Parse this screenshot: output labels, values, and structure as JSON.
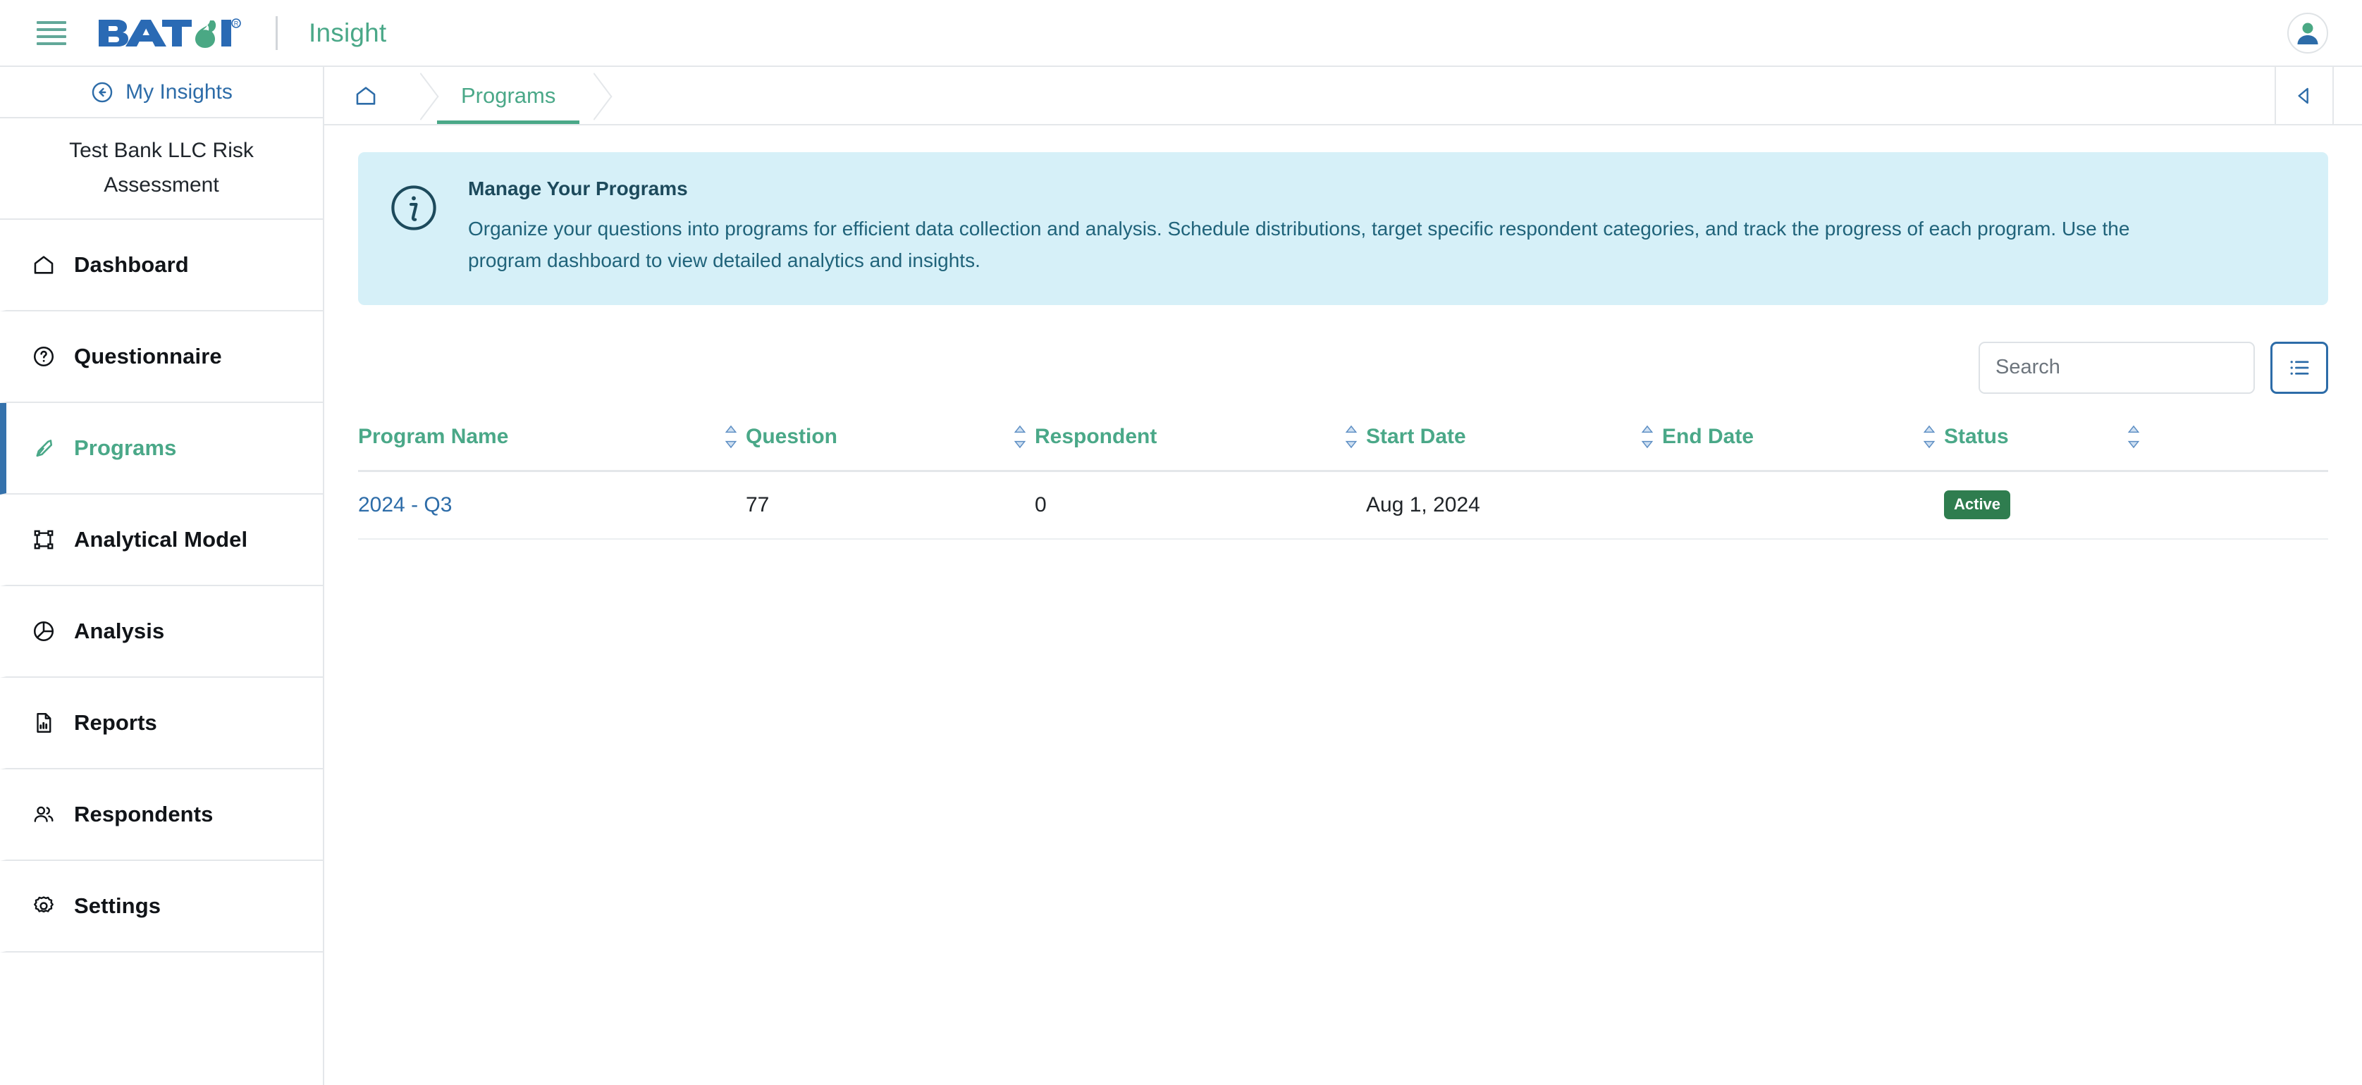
{
  "topbar": {
    "menu_icon": "hamburger-icon",
    "logo_text": "BATOI",
    "logo_tm": "®",
    "app_name": "Insight",
    "avatar_icon": "user-avatar-icon"
  },
  "sidebar": {
    "back_link": "My Insights",
    "back_icon": "arrow-left-circle-icon",
    "org_name": "Test Bank LLC Risk Assessment",
    "items": [
      {
        "label": "Dashboard",
        "icon": "home-icon",
        "active": false
      },
      {
        "label": "Questionnaire",
        "icon": "question-circle-icon",
        "active": false
      },
      {
        "label": "Programs",
        "icon": "pen-nib-icon",
        "active": true
      },
      {
        "label": "Analytical Model",
        "icon": "frame-corners-icon",
        "active": false
      },
      {
        "label": "Analysis",
        "icon": "pie-chart-icon",
        "active": false
      },
      {
        "label": "Reports",
        "icon": "file-bar-chart-icon",
        "active": false
      },
      {
        "label": "Respondents",
        "icon": "users-icon",
        "active": false
      },
      {
        "label": "Settings",
        "icon": "gear-icon",
        "active": false
      }
    ]
  },
  "breadcrumb": {
    "home_icon": "home-icon",
    "current": "Programs",
    "collapse_icon": "caret-left-icon"
  },
  "banner": {
    "icon": "info-circle-icon",
    "title": "Manage Your Programs",
    "body": "Organize your questions into programs for efficient data collection and analysis. Schedule distributions, target specific respondent categories, and track the progress of each program. Use the program dashboard to view detailed analytics and insights."
  },
  "toolbar": {
    "search_placeholder": "Search",
    "search_value": "",
    "view_toggle_icon": "list-view-icon"
  },
  "table": {
    "columns": [
      {
        "label": "Program Name",
        "sortable": true
      },
      {
        "label": "Question",
        "sortable": true
      },
      {
        "label": "Respondent",
        "sortable": true
      },
      {
        "label": "Start Date",
        "sortable": true
      },
      {
        "label": "End Date",
        "sortable": true
      },
      {
        "label": "Status",
        "sortable": true
      },
      {
        "label": "",
        "sortable": true
      }
    ],
    "rows": [
      {
        "program_name": "2024 - Q3",
        "question": "77",
        "respondent": "0",
        "start_date": "Aug 1, 2024",
        "end_date": "",
        "status": "Active"
      }
    ]
  },
  "colors": {
    "brand_blue": "#2d6ca8",
    "brand_green": "#4aa888",
    "logo_blue": "#2a6ab4",
    "logo_green": "#4aa884",
    "banner_bg": "#d6f0f8",
    "banner_text": "#20637a",
    "status_active": "#2f7d4f",
    "active_nav_accent": "#3572ac"
  }
}
